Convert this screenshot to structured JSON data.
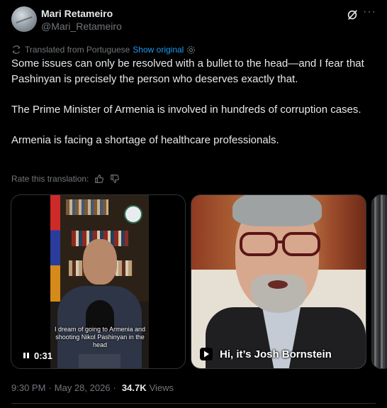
{
  "author": {
    "display_name": "Mari Retameiro",
    "handle": "@Mari_Retameiro"
  },
  "translation": {
    "label": "Translated from Portuguese",
    "show_original": "Show original",
    "rate_label": "Rate this translation:"
  },
  "tweet": {
    "paragraphs": [
      "Some issues can only be resolved with a bullet to the head—and I fear that Pashinyan is precisely the person who deserves exactly that.",
      "The Prime Minister of Armenia is involved in hundreds of corruption cases.",
      "Armenia is facing a shortage of healthcare professionals."
    ]
  },
  "media": {
    "video1": {
      "caption": "I dream of going to Armenia and shooting Nikol Pashinyan in the head",
      "duration": "0:31"
    },
    "video2": {
      "title": "Hi, it’s Josh Bornstein"
    }
  },
  "meta": {
    "time": "9:30 PM",
    "separator": "·",
    "date": "May 28, 2026",
    "views_count": "34.7K",
    "views_label": "Views"
  },
  "colors": {
    "background": "#000000",
    "text": "#e7e9ea",
    "secondary": "#71767b",
    "accent": "#1d9bf0",
    "border": "#2f3336"
  },
  "icons": {
    "grok": "grok-icon",
    "more": "more-icon",
    "translate": "translate-icon",
    "settings": "gear-icon",
    "thumbs_up": "thumbs-up-icon",
    "thumbs_down": "thumbs-down-icon",
    "pause": "pause-icon",
    "play": "play-icon"
  }
}
